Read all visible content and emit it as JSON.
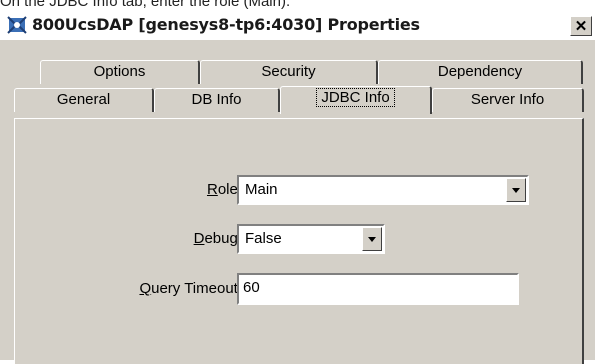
{
  "caption": "On the JDBC Info tab, enter the role (Main).",
  "window": {
    "title": "800UcsDAP [genesys8-tp6:4030] Properties",
    "close_label": "✕"
  },
  "tabs": {
    "row1": [
      {
        "label": "Options"
      },
      {
        "label": "Security"
      },
      {
        "label": "Dependency"
      }
    ],
    "row2": [
      {
        "label": "General"
      },
      {
        "label": "DB Info"
      },
      {
        "label": "JDBC Info",
        "active": true
      },
      {
        "label": "Server Info"
      }
    ]
  },
  "form": {
    "role": {
      "label_accel": "R",
      "label_rest": "ole:",
      "value": "Main"
    },
    "debug": {
      "label_accel": "D",
      "label_rest": "ebug:",
      "value": "False"
    },
    "query_timeout": {
      "label_accel": "Q",
      "label_rest": "uery Timeout:",
      "value": "60"
    }
  }
}
